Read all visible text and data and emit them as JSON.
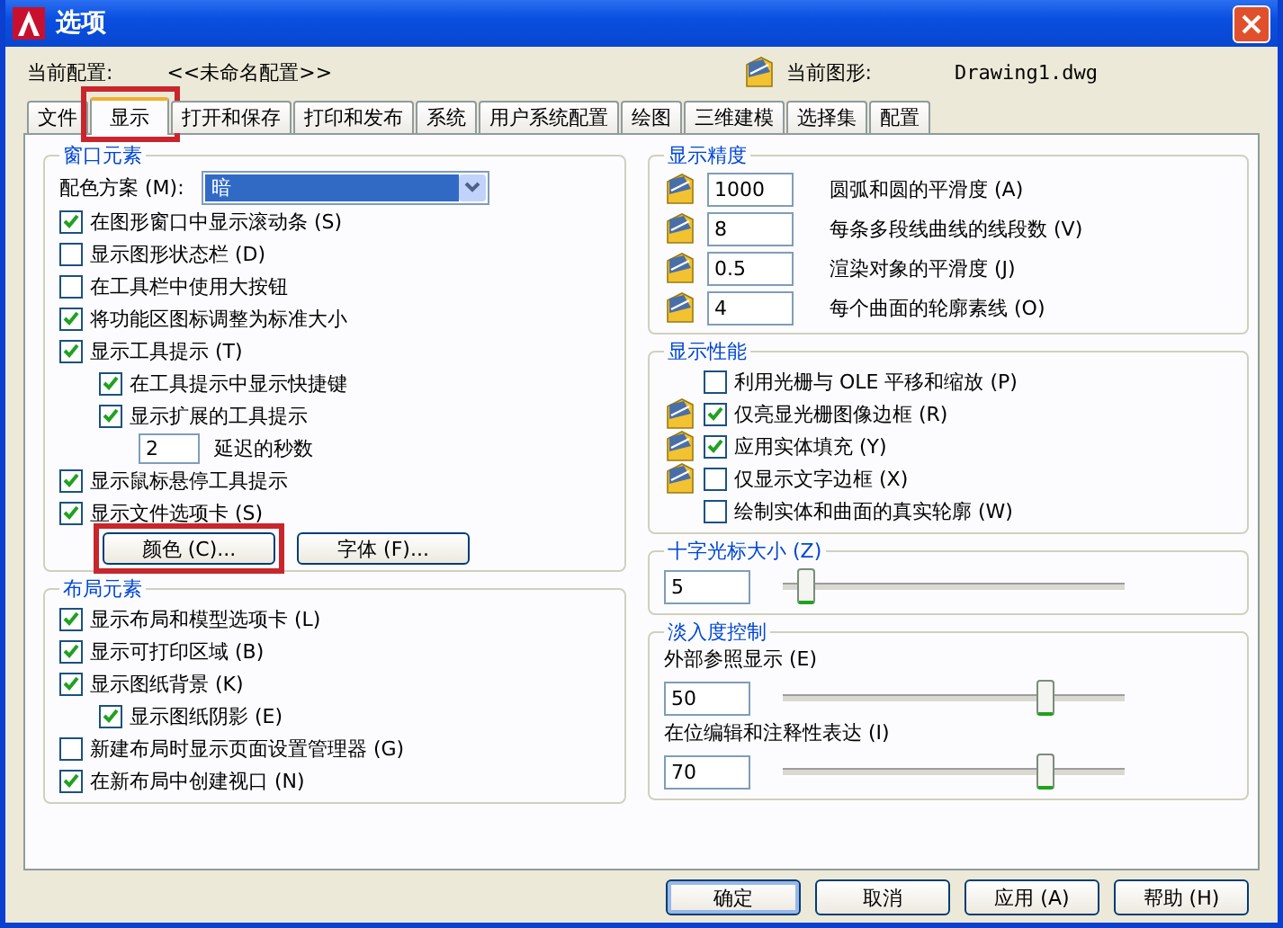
{
  "window": {
    "title": "选项"
  },
  "profile": {
    "label": "当前配置:",
    "value": "<<未命名配置>>"
  },
  "drawing": {
    "label": "当前图形:",
    "value": "Drawing1.dwg"
  },
  "tabs": [
    {
      "label": "文件",
      "selected": false,
      "highlighted": false
    },
    {
      "label": "显示",
      "selected": true,
      "highlighted": true
    },
    {
      "label": "打开和保存",
      "selected": false,
      "highlighted": false
    },
    {
      "label": "打印和发布",
      "selected": false,
      "highlighted": false
    },
    {
      "label": "系统",
      "selected": false,
      "highlighted": false
    },
    {
      "label": "用户系统配置",
      "selected": false,
      "highlighted": false
    },
    {
      "label": "绘图",
      "selected": false,
      "highlighted": false
    },
    {
      "label": "三维建模",
      "selected": false,
      "highlighted": false
    },
    {
      "label": "选择集",
      "selected": false,
      "highlighted": false
    },
    {
      "label": "配置",
      "selected": false,
      "highlighted": false
    }
  ],
  "window_elements": {
    "title": "窗口元素",
    "scheme": {
      "label": "配色方案 (M):",
      "value": "暗"
    },
    "items": [
      {
        "kind": "checkbox",
        "label": "在图形窗口中显示滚动条 (S)",
        "checked": true
      },
      {
        "kind": "checkbox",
        "label": "显示图形状态栏 (D)",
        "checked": false
      },
      {
        "kind": "checkbox",
        "label": "在工具栏中使用大按钮",
        "checked": false
      },
      {
        "kind": "checkbox",
        "label": "将功能区图标调整为标准大小",
        "checked": true
      },
      {
        "kind": "checkbox",
        "label": "显示工具提示 (T)",
        "checked": true,
        "children": [
          {
            "kind": "checkbox",
            "label": "在工具提示中显示快捷键",
            "checked": true
          },
          {
            "kind": "checkbox",
            "label": "显示扩展的工具提示",
            "checked": true,
            "children": [
              {
                "kind": "number",
                "value": "2",
                "label": "延迟的秒数"
              }
            ]
          }
        ]
      },
      {
        "kind": "checkbox",
        "label": "显示鼠标悬停工具提示",
        "checked": true
      },
      {
        "kind": "checkbox",
        "label": "显示文件选项卡 (S)",
        "checked": true
      }
    ],
    "buttons": [
      {
        "label": "颜色 (C)...",
        "highlighted": true
      },
      {
        "label": "字体 (F)...",
        "highlighted": false
      }
    ]
  },
  "layout_elements": {
    "title": "布局元素",
    "items": [
      {
        "kind": "checkbox",
        "label": "显示布局和模型选项卡 (L)",
        "checked": true
      },
      {
        "kind": "checkbox",
        "label": "显示可打印区域 (B)",
        "checked": true
      },
      {
        "kind": "checkbox",
        "label": "显示图纸背景 (K)",
        "checked": true,
        "children": [
          {
            "kind": "checkbox",
            "label": "显示图纸阴影 (E)",
            "checked": true
          }
        ]
      },
      {
        "kind": "checkbox",
        "label": "新建布局时显示页面设置管理器 (G)",
        "checked": false
      },
      {
        "kind": "checkbox",
        "label": "在新布局中创建视口 (N)",
        "checked": true
      }
    ]
  },
  "display_resolution": {
    "title": "显示精度",
    "items": [
      {
        "value": "1000",
        "label": "圆弧和圆的平滑度 (A)",
        "saved_in_drawing": true
      },
      {
        "value": "8",
        "label": "每条多段线曲线的线段数 (V)",
        "saved_in_drawing": true
      },
      {
        "value": "0.5",
        "label": "渲染对象的平滑度 (J)",
        "saved_in_drawing": true
      },
      {
        "value": "4",
        "label": "每个曲面的轮廓素线 (O)",
        "saved_in_drawing": true
      }
    ]
  },
  "display_performance": {
    "title": "显示性能",
    "items": [
      {
        "label": "利用光栅与 OLE 平移和缩放 (P)",
        "checked": false,
        "saved_in_drawing": false
      },
      {
        "label": "仅亮显光栅图像边框 (R)",
        "checked": true,
        "saved_in_drawing": true
      },
      {
        "label": "应用实体填充 (Y)",
        "checked": true,
        "saved_in_drawing": true
      },
      {
        "label": "仅显示文字边框 (X)",
        "checked": false,
        "saved_in_drawing": true
      },
      {
        "label": "绘制实体和曲面的真实轮廓 (W)",
        "checked": false,
        "saved_in_drawing": false
      }
    ]
  },
  "crosshair": {
    "title": "十字光标大小 (Z)",
    "value": "5",
    "level": 0.07
  },
  "fade": {
    "title": "淡入度控制",
    "sliders": [
      {
        "label": "外部参照显示 (E)",
        "value": "50",
        "level": 0.77
      },
      {
        "label": "在位编辑和注释性表达 (I)",
        "value": "70",
        "level": 0.77
      }
    ]
  },
  "buttons": [
    {
      "label": "确定",
      "default": true
    },
    {
      "label": "取消",
      "default": false
    },
    {
      "label": "应用 (A)",
      "default": false
    },
    {
      "label": "帮助 (H)",
      "default": false
    }
  ]
}
